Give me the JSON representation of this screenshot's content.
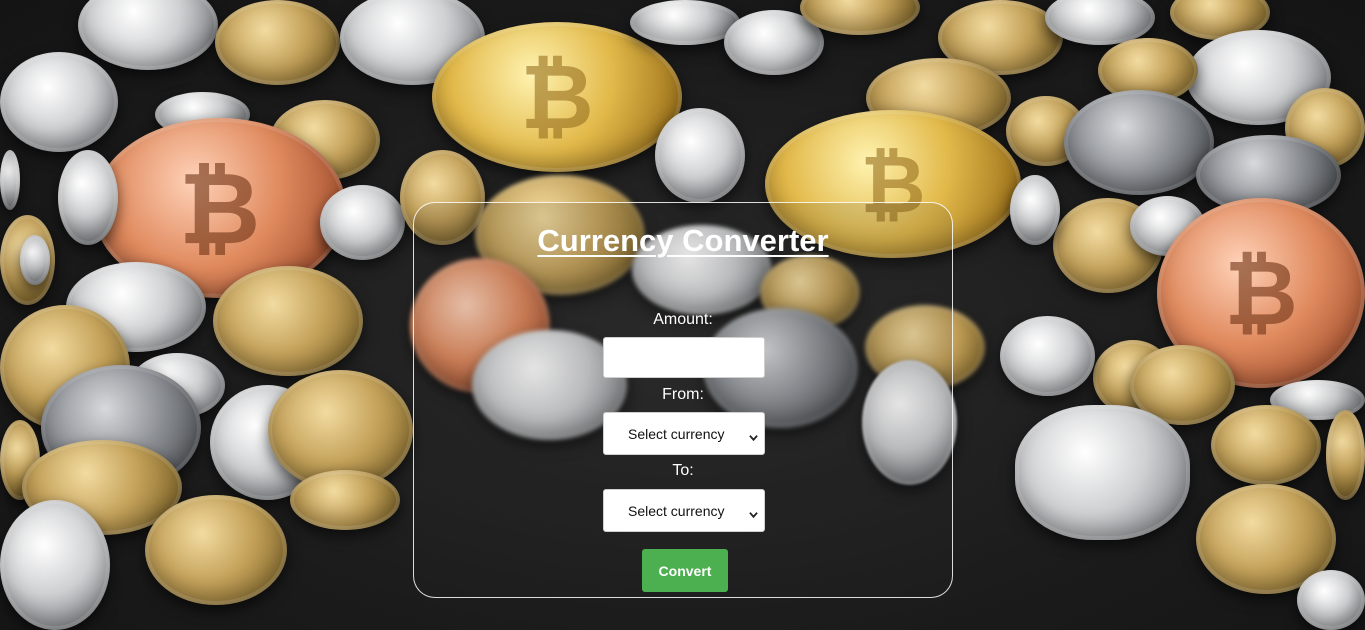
{
  "converter": {
    "title": "Currency Converter",
    "amount_label": "Amount:",
    "amount_value": "",
    "amount_placeholder": "",
    "from_label": "From:",
    "from_selected": "Select currency",
    "to_label": "To:",
    "to_selected": "Select currency",
    "convert_label": "Convert"
  },
  "icons": {
    "select_arrow": "chevron-down-icon"
  },
  "colors": {
    "button_green": "#4caf50",
    "panel_border": "#ffffff",
    "text": "#ffffff"
  }
}
